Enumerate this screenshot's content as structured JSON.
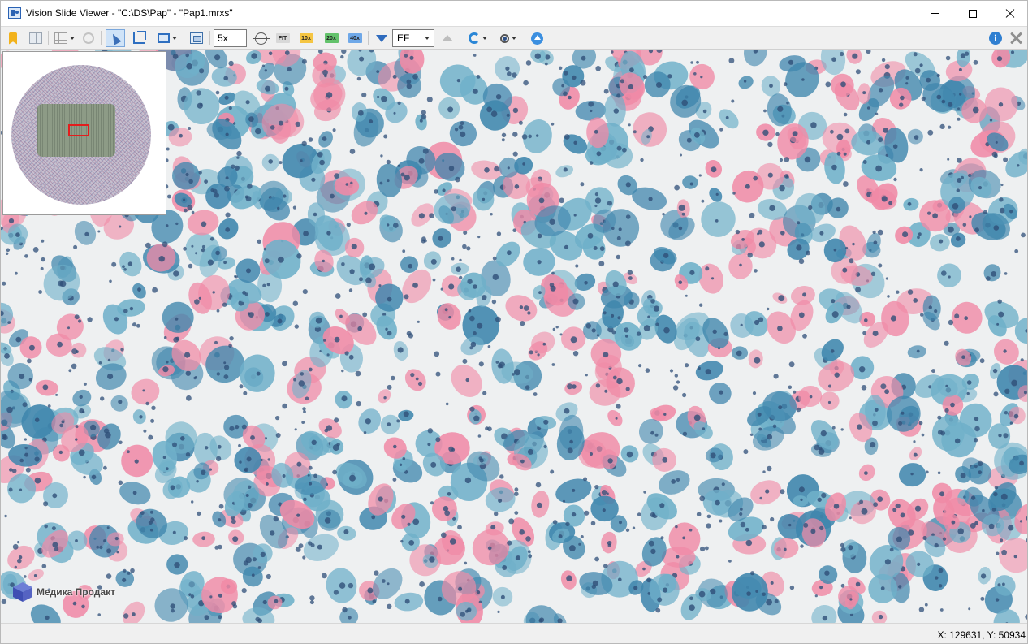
{
  "window": {
    "title": "Vision Slide Viewer - \"C:\\DS\\Pap\" - \"Pap1.mrxs\"",
    "controls": [
      "minimize",
      "maximize",
      "close"
    ]
  },
  "toolbar": {
    "zoom_value": "5x",
    "magnifications": [
      "FIT",
      "10x",
      "20x",
      "40x"
    ],
    "magnification_colors": [
      "#d8d8d8",
      "#f5c542",
      "#63c26b",
      "#6fa8e8"
    ],
    "filter_select": "EF",
    "icons": [
      "bookmark-icon",
      "split-view-icon",
      "grid-icon",
      "link-icon",
      "select-pointer-icon",
      "crop-icon",
      "rectangle-icon",
      "pan-view-icon",
      "center-target-icon",
      "filter-icon",
      "arrow-up-icon",
      "rotate-icon",
      "dot-icon",
      "upload-icon",
      "info-icon",
      "tools-icon"
    ]
  },
  "overview": {
    "image": "slide-overview-thumbnail",
    "region_color": "#e31d1d"
  },
  "viewer": {
    "image": "pap-smear-microscopy-field",
    "stain_colors": [
      "#f08aa6",
      "#6fb0c9",
      "#3f86ad",
      "#2f4f78"
    ]
  },
  "watermark": {
    "text": "Медика Продакт"
  },
  "status": {
    "coordinates": "X: 129631, Y: 50934"
  }
}
